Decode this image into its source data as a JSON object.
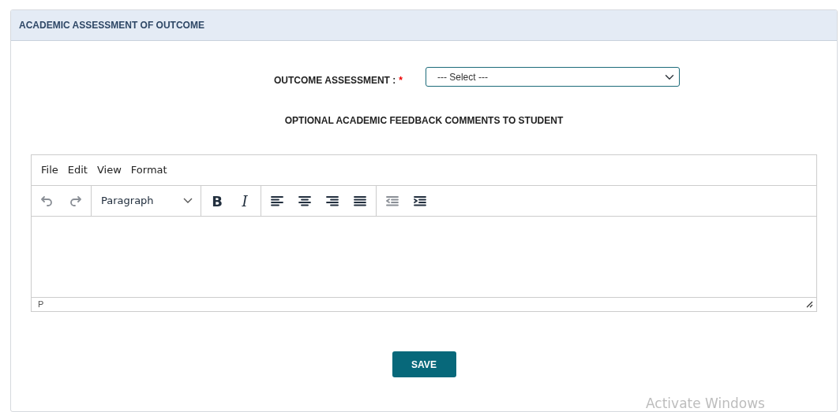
{
  "panel": {
    "title": "ACADEMIC ASSESSMENT OF OUTCOME"
  },
  "outcome_field": {
    "label": "OUTCOME ASSESSMENT :",
    "required_mark": "*",
    "value": "--- Select ---"
  },
  "feedback_title": "OPTIONAL ACADEMIC FEEDBACK COMMENTS TO STUDENT",
  "editor": {
    "menu": [
      "File",
      "Edit",
      "View",
      "Format"
    ],
    "toolbar": [
      {
        "kind": "icons",
        "buttons": [
          {
            "disabled": true
          },
          {
            "disabled": true
          }
        ]
      },
      {
        "kind": "dropdown",
        "label": "Paragraph"
      },
      {
        "kind": "letters",
        "buttons": [
          {
            "label": "B",
            "disabled": false
          },
          {
            "label": "I",
            "disabled": false
          }
        ]
      },
      {
        "kind": "icons",
        "buttons": [
          {
            "disabled": false
          },
          {
            "disabled": false
          },
          {
            "disabled": false
          },
          {
            "disabled": false
          }
        ]
      },
      {
        "kind": "icons",
        "buttons": [
          {
            "disabled": true
          },
          {
            "disabled": false
          }
        ]
      }
    ],
    "status_path": "P"
  },
  "save_button": "SAVE",
  "os_notice": "Activate Windows"
}
